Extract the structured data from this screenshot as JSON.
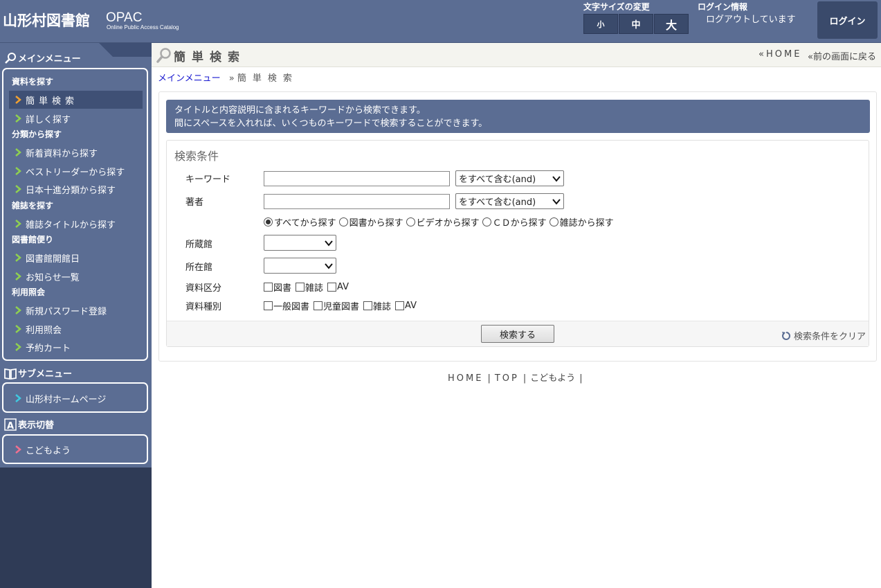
{
  "header": {
    "site_title": "山形村図書館",
    "opac": "OPAC",
    "opac_sub": "Online Public Access Catalog",
    "font_size_label": "文字サイズの変更",
    "font_sizes": [
      "小",
      "中",
      "大"
    ],
    "login_info_label": "ログイン情報",
    "login_status": "ログアウトしています",
    "login_button": "ログイン"
  },
  "sidebar": {
    "main_menu_title": "メインメニュー",
    "groups": [
      {
        "title": "資料を探す",
        "items": [
          "簡単検索",
          "詳しく探す"
        ]
      },
      {
        "title": "分類から探す",
        "items": [
          "新着資料から探す",
          "ベストリーダーから探す",
          "日本十進分類から探す"
        ]
      },
      {
        "title": "雑誌を探す",
        "items": [
          "雑誌タイトルから探す"
        ]
      },
      {
        "title": "図書館便り",
        "items": [
          "図書館開館日",
          "お知らせ一覧"
        ]
      },
      {
        "title": "利用照会",
        "items": [
          "新規パスワード登録",
          "利用照会",
          "予約カート"
        ]
      }
    ],
    "sub_menu_title": "サブメニュー",
    "sub_items": [
      "山形村ホームページ"
    ],
    "display_title": "表示切替",
    "display_items": [
      "こどもよう"
    ]
  },
  "titlebar": {
    "title": "簡単検索",
    "home": "HOME",
    "back": "前の画面に戻る"
  },
  "breadcrumb": {
    "link": "メインメニュー",
    "current": "簡単検索"
  },
  "info": {
    "line1": "タイトルと内容説明に含まれるキーワードから検索できます。",
    "line2": "間にスペースを入れれば、いくつものキーワードで検索することができます。"
  },
  "search": {
    "title": "検索条件",
    "keyword_label": "キーワード",
    "keyword_value": "",
    "keyword_mode": "をすべて含む(and)",
    "author_label": "著者",
    "author_value": "",
    "author_mode": "をすべて含む(and)",
    "radios": [
      "すべてから探す",
      "図書から探す",
      "ビデオから探す",
      "ＣＤから探す",
      "雑誌から探す"
    ],
    "selected_radio": 0,
    "holding_label": "所蔵館",
    "holding_value": "",
    "location_label": "所在館",
    "location_value": "",
    "material_label": "資料区分",
    "materials": [
      "図書",
      "雑誌",
      "AV"
    ],
    "type_label": "資料種別",
    "types": [
      "一般図書",
      "児童図書",
      "雑誌",
      "AV"
    ],
    "submit": "検索する",
    "clear": "検索条件をクリア"
  },
  "footer": {
    "links": [
      "HOME",
      "TOP",
      "こどもよう"
    ]
  },
  "colors": {
    "header_bg": "#5b6d93",
    "sidebar_dark": "#2f3b56",
    "chev_active": "#f0a030",
    "chev_normal": "#8fd050",
    "chev_sub": "#40c8e0",
    "chev_kids": "#f07090"
  }
}
